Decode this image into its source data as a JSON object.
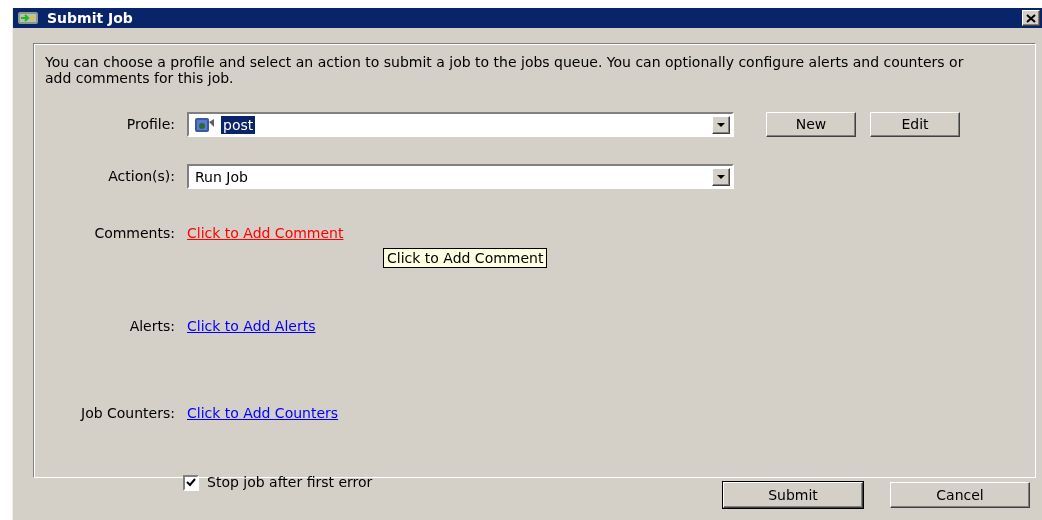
{
  "window": {
    "title": "Submit Job"
  },
  "description": "You can choose a profile and select an action to submit a job to the jobs queue. You can optionally configure alerts and counters or add comments for this job.",
  "profile": {
    "label": "Profile:",
    "value": "post",
    "selected": true
  },
  "profile_buttons": [
    "New",
    "Edit"
  ],
  "action": {
    "label": "Action(s):",
    "value": "Run Job"
  },
  "links": [
    {
      "label": "Comments:",
      "link": "Click to Add Comment",
      "color": "#ff0000"
    },
    {
      "label": "Alerts:",
      "link": "Click to Add Alerts",
      "color": "#0000ff"
    },
    {
      "label": "Job Counters:",
      "link": "Click to Add Counters",
      "color": "#0000ff"
    }
  ],
  "tooltip": "Click to Add Comment",
  "stop_on_error": {
    "label": "Stop job after first error",
    "checked": true
  },
  "buttons": [
    "Submit",
    "Cancel"
  ]
}
